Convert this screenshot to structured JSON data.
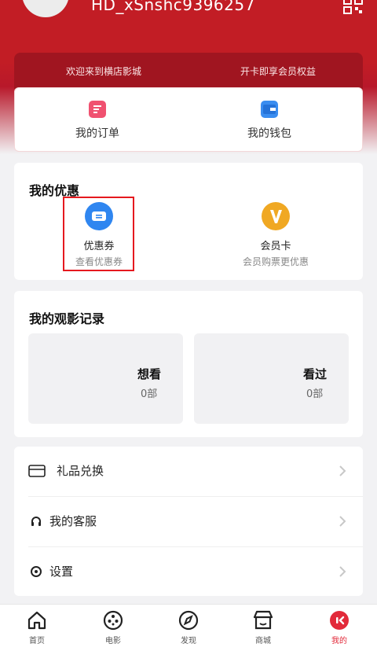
{
  "header": {
    "username": "HD_xSnshc9396257",
    "banner_left": "欢迎来到横店影城",
    "banner_right": "开卡即享会员权益"
  },
  "quick_actions": [
    {
      "label": "我的订单",
      "icon": "order-icon",
      "color": "#f05170"
    },
    {
      "label": "我的钱包",
      "icon": "wallet-icon",
      "color": "#3a8df0"
    }
  ],
  "promotions": {
    "title": "我的优惠",
    "items": [
      {
        "name": "优惠券",
        "sub": "查看优惠券",
        "icon": "coupon-icon",
        "color": "#2f86f0"
      },
      {
        "name": "会员卡",
        "sub": "会员购票更优惠",
        "icon": "vip-card-icon",
        "color": "#f0a823"
      }
    ]
  },
  "watch_history": {
    "title": "我的观影记录",
    "items": [
      {
        "title": "想看",
        "count": "0部"
      },
      {
        "title": "看过",
        "count": "0部"
      }
    ]
  },
  "menu": [
    {
      "label": "礼品兑换",
      "icon": "gift-card-icon"
    },
    {
      "label": "我的客服",
      "icon": "headset-icon"
    },
    {
      "label": "设置",
      "icon": "settings-icon"
    }
  ],
  "tabbar": [
    {
      "label": "首页",
      "icon": "home-icon"
    },
    {
      "label": "电影",
      "icon": "film-reel-icon"
    },
    {
      "label": "发现",
      "icon": "compass-icon"
    },
    {
      "label": "商城",
      "icon": "store-icon"
    },
    {
      "label": "我的",
      "icon": "profile-icon",
      "active": true
    }
  ],
  "colors": {
    "brand_red": "#c21d25",
    "active_tab": "#e22a3a",
    "highlight_border": "#e5191f"
  }
}
